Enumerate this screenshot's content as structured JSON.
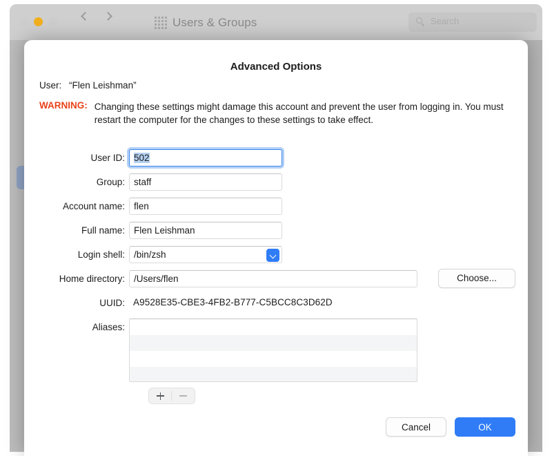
{
  "background_window": {
    "title": "Users & Groups",
    "traffic_lights": [
      {
        "name": "close",
        "color": "#cdcdcd"
      },
      {
        "name": "minimize",
        "color": "#f2b01e"
      },
      {
        "name": "zoom",
        "color": "#cdcdcd"
      }
    ],
    "nav": {
      "back_icon": "chevron-left-icon",
      "forward_icon": "chevron-right-icon"
    },
    "grid_icon": "grid-apps-icon",
    "search": {
      "icon": "search-icon",
      "placeholder": "Search",
      "value": ""
    }
  },
  "dialog": {
    "title": "Advanced Options",
    "user_label": "User:",
    "user_value": "“Flen Leishman”",
    "warning_tag": "WARNING:",
    "warning_text": "Changing these settings might damage this account and prevent the user from logging in. You must restart the computer for the changes to these settings to take effect.",
    "fields": {
      "user_id": {
        "label": "User ID:",
        "value": "502",
        "focused": true,
        "selected": true
      },
      "group": {
        "label": "Group:",
        "value": "staff",
        "focused": false,
        "selected": false
      },
      "account_name": {
        "label": "Account name:",
        "value": "flen",
        "focused": false,
        "selected": false
      },
      "full_name": {
        "label": "Full name:",
        "value": "Flen Leishman",
        "focused": false,
        "selected": false
      },
      "login_shell": {
        "label": "Login shell:",
        "value": "/bin/zsh",
        "popup_icon": "chevron-down-icon"
      },
      "home_directory": {
        "label": "Home directory:",
        "value": "/Users/flen"
      },
      "uuid": {
        "label": "UUID:",
        "value": "A9528E35-CBE3-4FB2-B777-C5BCC8C3D62D"
      },
      "aliases": {
        "label": "Aliases:",
        "items": []
      }
    },
    "choose_button": "Choose...",
    "add_alias_icon": "plus-icon",
    "remove_alias_icon": "minus-icon",
    "cancel_button": "Cancel",
    "ok_button": "OK"
  },
  "colors": {
    "accent": "#2f7cf6",
    "warning": "#e8421a",
    "selection": "#b4d0f0",
    "focus_ring": "#4c8eea"
  }
}
